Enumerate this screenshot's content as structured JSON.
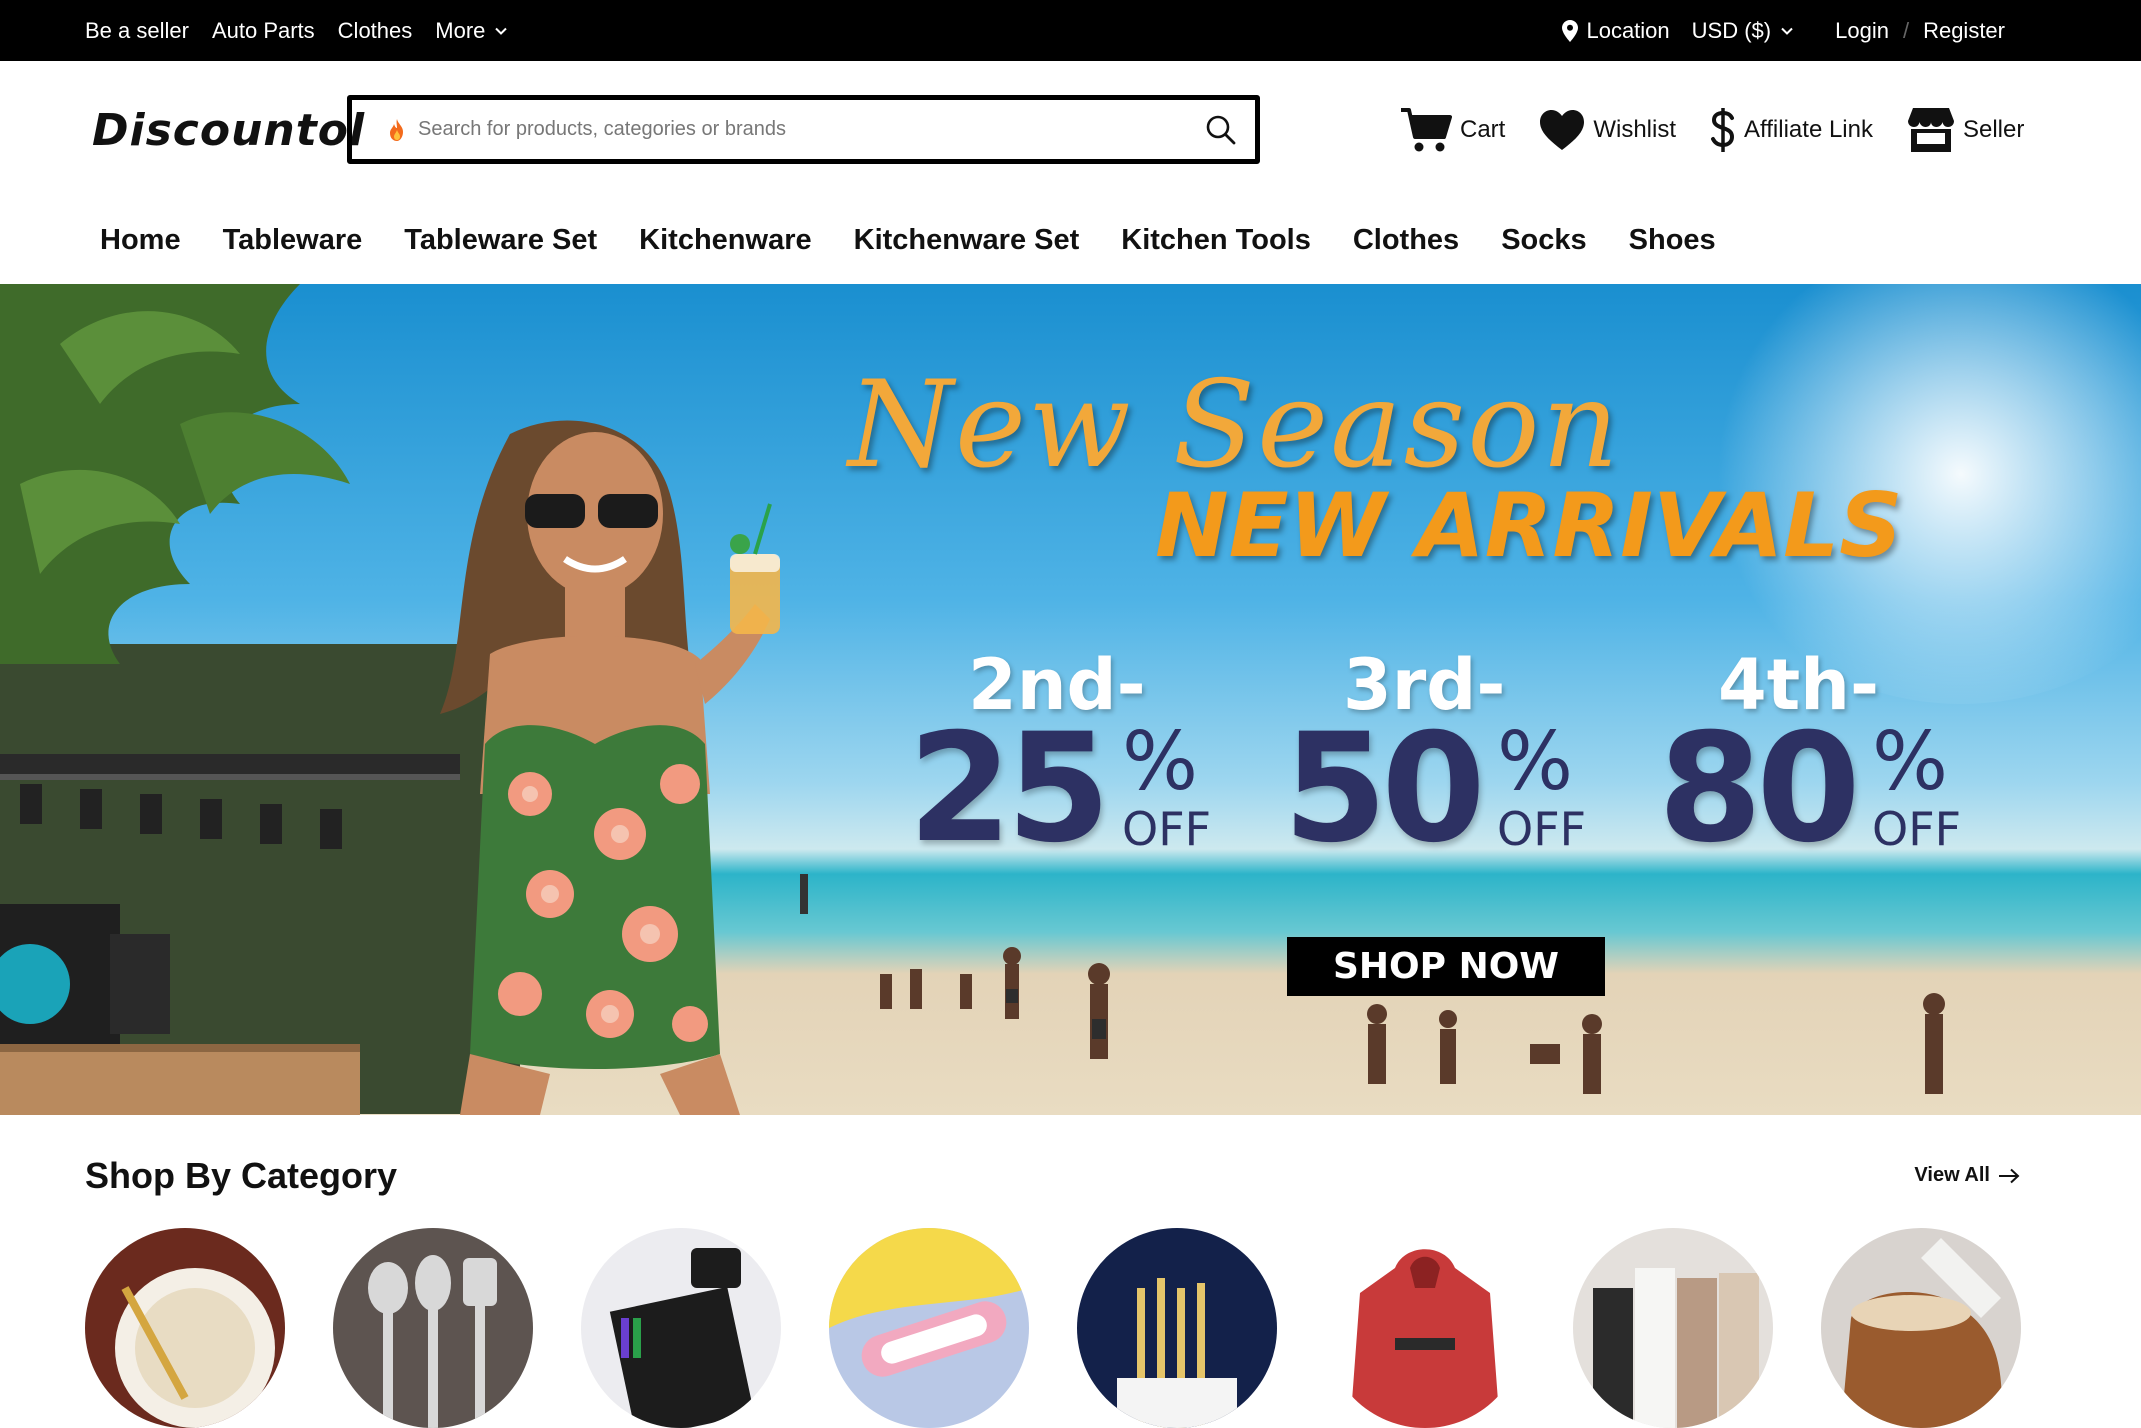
{
  "topbar": {
    "left_links": [
      "Be a seller",
      "Auto Parts",
      "Clothes",
      "More"
    ],
    "location": "Location",
    "currency": "USD ($)",
    "login": "Login",
    "separator": "/",
    "register": "Register"
  },
  "header": {
    "logo": "Discountol",
    "search_placeholder": "Search for products, categories or brands",
    "links": {
      "cart": "Cart",
      "wishlist": "Wishlist",
      "affiliate": "Affiliate Link",
      "seller": "Seller"
    }
  },
  "nav": [
    "Home",
    "Tableware",
    "Tableware Set",
    "Kitchenware",
    "Kitchenware Set",
    "Kitchen Tools",
    "Clothes",
    "Socks",
    "Shoes"
  ],
  "hero": {
    "script_title": "New Season",
    "headline": "NEW ARRIVALS",
    "offers": [
      {
        "label": "2nd-",
        "value": "25",
        "percent": "%",
        "off": "OFF"
      },
      {
        "label": "3rd-",
        "value": "50",
        "percent": "%",
        "off": "OFF"
      },
      {
        "label": "4th-",
        "value": "80",
        "percent": "%",
        "off": "OFF"
      }
    ],
    "cta": "SHOP NOW"
  },
  "categories": {
    "title": "Shop By Category",
    "view_all": "View All",
    "items": [
      "tableware",
      "kitchen-utensils",
      "knife-set",
      "cutlery-case",
      "flatware",
      "hoodie",
      "socks",
      "boots"
    ]
  },
  "colors": {
    "topbar_bg": "#000000",
    "headline_orange": "#f39a1b",
    "script_orange": "#f2a83a",
    "offer_navy": "#2d3163"
  }
}
